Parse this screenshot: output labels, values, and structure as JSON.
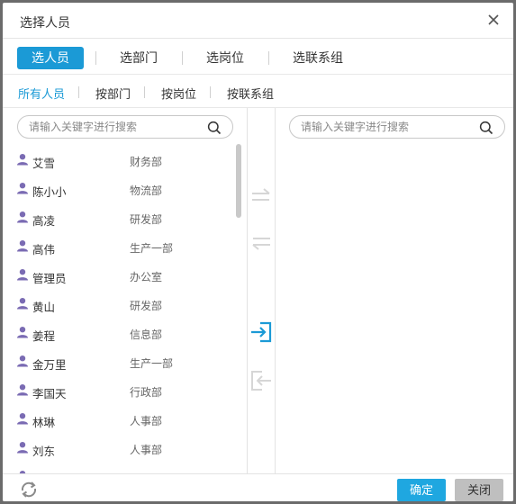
{
  "dialog": {
    "title": "选择人员",
    "close_icon": "close-icon"
  },
  "tabs": [
    {
      "label": "选人员",
      "active": true
    },
    {
      "label": "选部门",
      "active": false
    },
    {
      "label": "选岗位",
      "active": false
    },
    {
      "label": "选联系组",
      "active": false
    }
  ],
  "subtabs": [
    {
      "label": "所有人员",
      "active": true
    },
    {
      "label": "按部门",
      "active": false
    },
    {
      "label": "按岗位",
      "active": false
    },
    {
      "label": "按联系组",
      "active": false
    }
  ],
  "left_search": {
    "placeholder": "请输入关键字进行搜索"
  },
  "right_search": {
    "placeholder": "请输入关键字进行搜索"
  },
  "people": [
    {
      "name": "艾雪",
      "dept": "财务部"
    },
    {
      "name": "陈小小",
      "dept": "物流部"
    },
    {
      "name": "高凌",
      "dept": "研发部"
    },
    {
      "name": "高伟",
      "dept": "生产一部"
    },
    {
      "name": "管理员",
      "dept": "办公室"
    },
    {
      "name": "黄山",
      "dept": "研发部"
    },
    {
      "name": "姜程",
      "dept": "信息部"
    },
    {
      "name": "金万里",
      "dept": "生产一部"
    },
    {
      "name": "李国天",
      "dept": "行政部"
    },
    {
      "name": "林琳",
      "dept": "人事部"
    },
    {
      "name": "刘东",
      "dept": "人事部"
    }
  ],
  "buttons": {
    "ok": "确定",
    "cancel": "关闭"
  },
  "colors": {
    "accent": "#1b9ad6",
    "user_icon": "#7a6bb3",
    "disabled_arrow": "#d6d6d6"
  }
}
